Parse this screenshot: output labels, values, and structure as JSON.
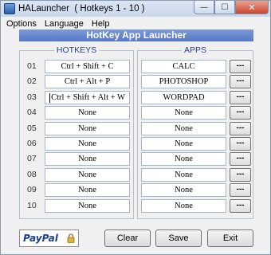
{
  "window": {
    "title": "HALauncher  ( Hotkeys 1 - 10 )",
    "controls": {
      "minimize": "—",
      "maximize": "☐",
      "close": "✕"
    }
  },
  "menu": [
    "Options",
    "Language",
    "Help"
  ],
  "header": {
    "title": "HotKey App Launcher"
  },
  "groups": {
    "hotkeys": "HOTKEYS",
    "apps": "APPS"
  },
  "rows": [
    {
      "num": "01",
      "hotkey": "Ctrl + Shift + C",
      "app": "CALC",
      "more": "---"
    },
    {
      "num": "02",
      "hotkey": "Ctrl + Alt + P",
      "app": "PHOTOSHOP",
      "more": "---"
    },
    {
      "num": "03",
      "hotkey": "Ctrl + Shift + Alt + W",
      "app": "WORDPAD",
      "more": "---"
    },
    {
      "num": "04",
      "hotkey": "None",
      "app": "None",
      "more": "---"
    },
    {
      "num": "05",
      "hotkey": "None",
      "app": "None",
      "more": "---"
    },
    {
      "num": "06",
      "hotkey": "None",
      "app": "None",
      "more": "---"
    },
    {
      "num": "07",
      "hotkey": "None",
      "app": "None",
      "more": "---"
    },
    {
      "num": "08",
      "hotkey": "None",
      "app": "None",
      "more": "---"
    },
    {
      "num": "09",
      "hotkey": "None",
      "app": "None",
      "more": "---"
    },
    {
      "num": "10",
      "hotkey": "None",
      "app": "None",
      "more": "---"
    }
  ],
  "active_row": 2,
  "footer": {
    "paypal": "PayPal",
    "clear": "Clear",
    "save": "Save",
    "exit": "Exit"
  },
  "colors": {
    "header_bg": "#6585cf",
    "group_title": "#2a3f8a",
    "paypal": "#1a3f8f"
  }
}
